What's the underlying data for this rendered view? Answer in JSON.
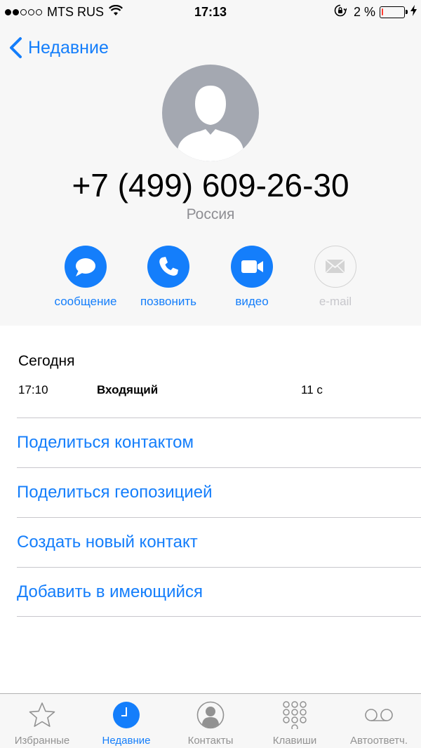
{
  "status_bar": {
    "carrier": "MTS RUS",
    "time": "17:13",
    "battery_percent_text": "2 %",
    "battery_level": 0.04,
    "signal_bars_filled": 2,
    "signal_bars_total": 5
  },
  "nav": {
    "back_label": "Недавние"
  },
  "contact": {
    "phone_number": "+7 (499) 609-26-30",
    "country": "Россия"
  },
  "actions": [
    {
      "label": "сообщение",
      "icon": "message-icon",
      "enabled": true
    },
    {
      "label": "позвонить",
      "icon": "phone-icon",
      "enabled": true
    },
    {
      "label": "видео",
      "icon": "video-icon",
      "enabled": true
    },
    {
      "label": "e-mail",
      "icon": "mail-icon",
      "enabled": false
    }
  ],
  "history": {
    "date": "Сегодня",
    "entries": [
      {
        "time": "17:10",
        "type": "Входящий",
        "duration": "11 с"
      }
    ]
  },
  "menu": [
    {
      "label": "Поделиться контактом"
    },
    {
      "label": "Поделиться геопозицией"
    },
    {
      "label": "Создать новый контакт"
    },
    {
      "label": "Добавить в имеющийся"
    }
  ],
  "tabs": [
    {
      "label": "Избранные",
      "icon": "star-icon",
      "active": false
    },
    {
      "label": "Недавние",
      "icon": "clock-icon",
      "active": true
    },
    {
      "label": "Контакты",
      "icon": "contacts-icon",
      "active": false
    },
    {
      "label": "Клавиши",
      "icon": "keypad-icon",
      "active": false
    },
    {
      "label": "Автоответч.",
      "icon": "voicemail-icon",
      "active": false
    }
  ],
  "colors": {
    "accent": "#147efb",
    "battery_low": "#ff3b30",
    "secondary_text": "#8e8e93",
    "disabled": "#c7c7cc",
    "avatar": "#a4a8b1"
  }
}
